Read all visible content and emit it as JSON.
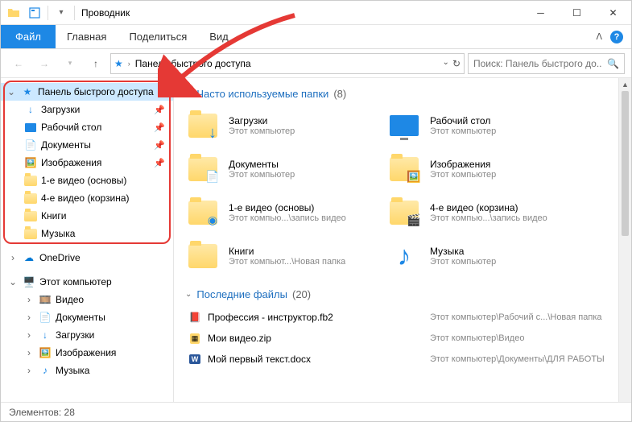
{
  "titlebar": {
    "title": "Проводник"
  },
  "ribbon": {
    "file": "Файл",
    "tabs": [
      "Главная",
      "Поделиться",
      "Вид"
    ]
  },
  "address": {
    "path": "Панель быстрого доступа",
    "search_placeholder": "Поиск: Панель быстрого до..."
  },
  "sidebar": {
    "quick_access": "Панель быстрого доступа",
    "items": [
      {
        "label": "Загрузки",
        "icon": "downloads",
        "pinned": true
      },
      {
        "label": "Рабочий стол",
        "icon": "desktop",
        "pinned": true
      },
      {
        "label": "Документы",
        "icon": "documents",
        "pinned": true
      },
      {
        "label": "Изображения",
        "icon": "pictures",
        "pinned": true
      },
      {
        "label": "1-е видео (основы)",
        "icon": "folder",
        "pinned": false
      },
      {
        "label": "4-е видео (корзина)",
        "icon": "folder",
        "pinned": false
      },
      {
        "label": "Книги",
        "icon": "folder",
        "pinned": false
      },
      {
        "label": "Музыка",
        "icon": "folder",
        "pinned": false
      }
    ],
    "onedrive": "OneDrive",
    "thispc": "Этот компьютер",
    "pc_items": [
      {
        "label": "Видео"
      },
      {
        "label": "Документы"
      },
      {
        "label": "Загрузки"
      },
      {
        "label": "Изображения"
      },
      {
        "label": "Музыка"
      }
    ]
  },
  "content": {
    "group1": {
      "title": "Часто используемые папки",
      "count": "(8)"
    },
    "tiles": [
      {
        "name": "Загрузки",
        "sub": "Этот компьютер",
        "icon": "downloads"
      },
      {
        "name": "Рабочий стол",
        "sub": "Этот компьютер",
        "icon": "desktop"
      },
      {
        "name": "Документы",
        "sub": "Этот компьютер",
        "icon": "documents"
      },
      {
        "name": "Изображения",
        "sub": "Этот компьютер",
        "icon": "pictures"
      },
      {
        "name": "1-е видео (основы)",
        "sub": "Этот компью...\\запись видео",
        "icon": "folder-media"
      },
      {
        "name": "4-е видео (корзина)",
        "sub": "Этот компью...\\запись видео",
        "icon": "folder-video"
      },
      {
        "name": "Книги",
        "sub": "Этот компьют...\\Новая папка",
        "icon": "folder"
      },
      {
        "name": "Музыка",
        "sub": "Этот компьютер",
        "icon": "music"
      }
    ],
    "group2": {
      "title": "Последние файлы",
      "count": "(20)"
    },
    "files": [
      {
        "name": "Профессия - инструктор.fb2",
        "path": "Этот компьютер\\Рабочий с...\\Новая папка",
        "icon": "fb2"
      },
      {
        "name": "Мои видео.zip",
        "path": "Этот компьютер\\Видео",
        "icon": "zip"
      },
      {
        "name": "Мой первый текст.docx",
        "path": "Этот компьютер\\Документы\\ДЛЯ РАБОТЫ",
        "icon": "docx"
      }
    ]
  },
  "statusbar": {
    "text": "Элементов: 28"
  }
}
